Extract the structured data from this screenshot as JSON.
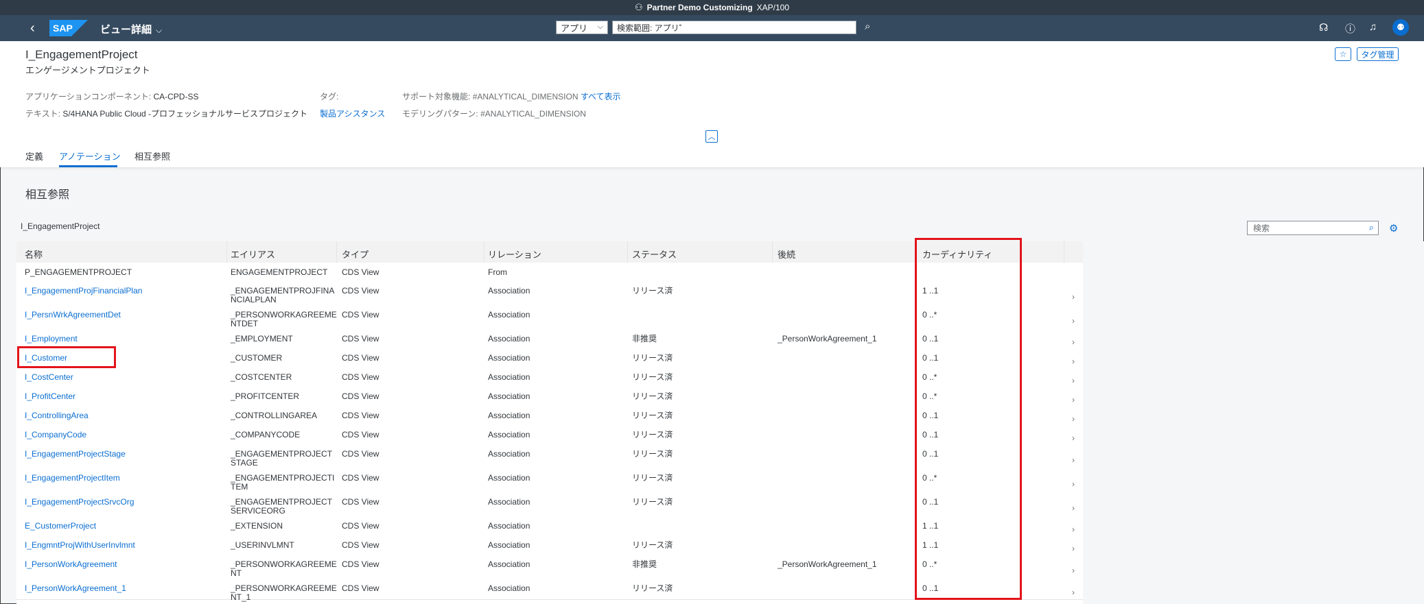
{
  "system_bar": {
    "title": "Partner Demo Customizing",
    "system": "XAP/100"
  },
  "shell": {
    "logo": "SAP",
    "app_title": "ビュー詳細",
    "search_scope": "アプリ",
    "search_value": "検索範囲: アプリ˚",
    "icons": [
      "back-icon",
      "search-icon",
      "help-headset-icon",
      "help-icon",
      "notification-icon",
      "user-icon"
    ]
  },
  "header": {
    "title": "I_EngagementProject",
    "subtitle": "エンゲージメントプロジェクト",
    "favorite_icon": "star-icon",
    "tag_button": "タグ管理",
    "app_component_label": "アプリケーションコンポーネント:",
    "app_component_value": "CA-CPD-SS",
    "text_label": "テキスト:",
    "text_value": "S/4HANA Public Cloud -プロフェッショナルサービスプロジェクト",
    "tag_label": "タグ:",
    "tag_link": "製品アシスタンス",
    "supported_label": "サポート対象機能:",
    "supported_value": "#ANALYTICAL_DIMENSION",
    "show_all": "すべて表示",
    "modeling_label": "モデリングパターン:",
    "modeling_value": "#ANALYTICAL_DIMENSION"
  },
  "tabs": [
    {
      "label": "定義",
      "active": false
    },
    {
      "label": "アノテーション",
      "active": true
    },
    {
      "label": "相互参照",
      "active": false
    }
  ],
  "section": {
    "title": "相互参照",
    "table_title": "I_EngagementProject",
    "search_placeholder": "検索"
  },
  "columns": [
    "名称",
    "エイリアス",
    "タイプ",
    "リレーション",
    "ステータス",
    "後続",
    "カーディナリティ"
  ],
  "rows": [
    {
      "name": "P_ENGAGEMENTPROJECT",
      "alias": "ENGAGEMENTPROJECT",
      "type": "CDS View",
      "relation": "From",
      "status": "",
      "successor": "",
      "cardinality": "",
      "link": false
    },
    {
      "name": "I_EngagementProjFinancialPlan",
      "alias": "_ENGAGEMENTPROJFINANCIALPLAN",
      "type": "CDS View",
      "relation": "Association",
      "status": "リリース済",
      "successor": "",
      "cardinality": "1 ..1",
      "link": true
    },
    {
      "name": "I_PersnWrkAgreementDet",
      "alias": "_PERSONWORKAGREEMENTDET",
      "type": "CDS View",
      "relation": "Association",
      "status": "",
      "successor": "",
      "cardinality": "0 ..*",
      "link": true
    },
    {
      "name": "I_Employment",
      "alias": "_EMPLOYMENT",
      "type": "CDS View",
      "relation": "Association",
      "status": "非推奨",
      "successor": "_PersonWorkAgreement_1",
      "cardinality": "0 ..1",
      "link": true
    },
    {
      "name": "I_Customer",
      "alias": "_CUSTOMER",
      "type": "CDS View",
      "relation": "Association",
      "status": "リリース済",
      "successor": "",
      "cardinality": "0 ..1",
      "link": true
    },
    {
      "name": "I_CostCenter",
      "alias": "_COSTCENTER",
      "type": "CDS View",
      "relation": "Association",
      "status": "リリース済",
      "successor": "",
      "cardinality": "0 ..*",
      "link": true
    },
    {
      "name": "I_ProfitCenter",
      "alias": "_PROFITCENTER",
      "type": "CDS View",
      "relation": "Association",
      "status": "リリース済",
      "successor": "",
      "cardinality": "0 ..*",
      "link": true
    },
    {
      "name": "I_ControllingArea",
      "alias": "_CONTROLLINGAREA",
      "type": "CDS View",
      "relation": "Association",
      "status": "リリース済",
      "successor": "",
      "cardinality": "0 ..1",
      "link": true
    },
    {
      "name": "I_CompanyCode",
      "alias": "_COMPANYCODE",
      "type": "CDS View",
      "relation": "Association",
      "status": "リリース済",
      "successor": "",
      "cardinality": "0 ..1",
      "link": true
    },
    {
      "name": "I_EngagementProjectStage",
      "alias": "_ENGAGEMENTPROJECTSTAGE",
      "type": "CDS View",
      "relation": "Association",
      "status": "リリース済",
      "successor": "",
      "cardinality": "0 ..1",
      "link": true
    },
    {
      "name": "I_EngagementProjectItem",
      "alias": "_ENGAGEMENTPROJECTITEM",
      "type": "CDS View",
      "relation": "Association",
      "status": "リリース済",
      "successor": "",
      "cardinality": "0 ..*",
      "link": true
    },
    {
      "name": "I_EngagementProjectSrvcOrg",
      "alias": "_ENGAGEMENTPROJECTSERVICEORG",
      "type": "CDS View",
      "relation": "Association",
      "status": "リリース済",
      "successor": "",
      "cardinality": "0 ..1",
      "link": true
    },
    {
      "name": "E_CustomerProject",
      "alias": "_EXTENSION",
      "type": "CDS View",
      "relation": "Association",
      "status": "",
      "successor": "",
      "cardinality": "1 ..1",
      "link": true
    },
    {
      "name": "I_EngmntProjWithUserInvlmnt",
      "alias": "_USERINVLMNT",
      "type": "CDS View",
      "relation": "Association",
      "status": "リリース済",
      "successor": "",
      "cardinality": "1 ..1",
      "link": true
    },
    {
      "name": "I_PersonWorkAgreement",
      "alias": "_PERSONWORKAGREEMENT",
      "type": "CDS View",
      "relation": "Association",
      "status": "非推奨",
      "successor": "_PersonWorkAgreement_1",
      "cardinality": "0 ..*",
      "link": true
    },
    {
      "name": "I_PersonWorkAgreement_1",
      "alias": "_PERSONWORKAGREEMENT_1",
      "type": "CDS View",
      "relation": "Association",
      "status": "リリース済",
      "successor": "",
      "cardinality": "0 ..1",
      "link": true
    }
  ],
  "colors": {
    "shell": "#354a5f",
    "accent": "#0a6ed1",
    "highlight": "#e3131a"
  }
}
